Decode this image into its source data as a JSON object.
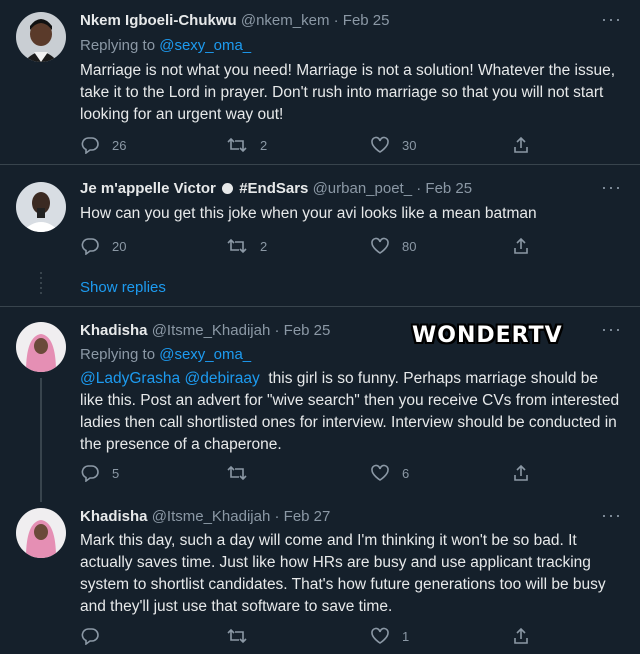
{
  "tweets": [
    {
      "name": "Nkem Igboeli-Chukwu",
      "handle": "@nkem_kem",
      "date": "Feb 25",
      "replying_prefix": "Replying to",
      "replying_to": "@sexy_oma_",
      "text": "Marriage is not what you need! Marriage is not a solution! Whatever the issue, take it to the Lord in prayer. Don't rush into marriage so that you will not start looking for an urgent way out!",
      "replies": "26",
      "retweets": "2",
      "likes": "30"
    },
    {
      "name": "Je m'appelle Victor",
      "name_suffix": "#EndSars",
      "handle": "@urban_poet_",
      "date": "Feb 25",
      "text": "How can you get this joke when your avi looks like a mean batman",
      "replies": "20",
      "retweets": "2",
      "likes": "80"
    },
    {
      "name": "Khadisha",
      "handle": "@Itsme_Khadijah",
      "date": "Feb 25",
      "replying_prefix": "Replying to",
      "replying_to": "@sexy_oma_",
      "mention_1": "@LadyGrasha",
      "mention_2": "@debiraay",
      "text": "this girl is so funny. Perhaps marriage should be like this. Post an advert for \"wive search\" then you receive CVs from interested ladies then call shortlisted ones for interview. Interview should be conducted in the presence of a chaperone.",
      "replies": "5",
      "retweets": "",
      "likes": "6"
    },
    {
      "name": "Khadisha",
      "handle": "@Itsme_Khadijah",
      "date": "Feb 27",
      "text": "Mark this day, such a day will come and I'm thinking it won't be so bad. It actually saves time. Just like how HRs are busy and use applicant tracking system to shortlist candidates. That's how future generations too will be busy and they'll just use that software to save time.",
      "replies": "",
      "retweets": "",
      "likes": "1"
    }
  ],
  "show_replies": "Show replies",
  "watermark": "WONDERTV",
  "more_glyph": "···",
  "separator": "·",
  "colors": {
    "background": "#15202b",
    "accent": "#1d9bf0",
    "muted": "#8b98a5",
    "divider": "#38444d"
  }
}
